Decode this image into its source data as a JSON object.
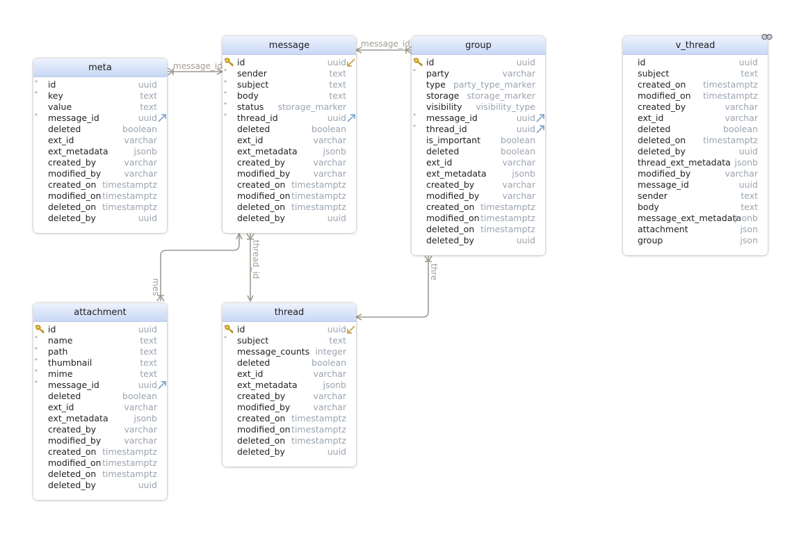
{
  "tables": {
    "meta": {
      "title": "meta",
      "rows": [
        {
          "name": "id",
          "type": "uuid",
          "nn": true
        },
        {
          "name": "key",
          "type": "text",
          "nn": true
        },
        {
          "name": "value",
          "type": "text",
          "nn": false
        },
        {
          "name": "message_id",
          "type": "uuid",
          "nn": true,
          "fk": true
        },
        {
          "name": "deleted",
          "type": "boolean",
          "nn": false
        },
        {
          "name": "ext_id",
          "type": "varchar",
          "nn": false
        },
        {
          "name": "ext_metadata",
          "type": "jsonb",
          "nn": false
        },
        {
          "name": "created_by",
          "type": "varchar",
          "nn": false
        },
        {
          "name": "modified_by",
          "type": "varchar",
          "nn": false
        },
        {
          "name": "created_on",
          "type": "timestamptz",
          "nn": false
        },
        {
          "name": "modified_on",
          "type": "timestamptz",
          "nn": false
        },
        {
          "name": "deleted_on",
          "type": "timestamptz",
          "nn": false
        },
        {
          "name": "deleted_by",
          "type": "uuid",
          "nn": false
        }
      ]
    },
    "message": {
      "title": "message",
      "rows": [
        {
          "name": "id",
          "type": "uuid",
          "nn": true,
          "pk": true,
          "ref": true
        },
        {
          "name": "sender",
          "type": "text",
          "nn": true
        },
        {
          "name": "subject",
          "type": "text",
          "nn": true
        },
        {
          "name": "body",
          "type": "text",
          "nn": true
        },
        {
          "name": "status",
          "type": "storage_marker",
          "nn": true
        },
        {
          "name": "thread_id",
          "type": "uuid",
          "nn": true,
          "fk": true
        },
        {
          "name": "deleted",
          "type": "boolean",
          "nn": false
        },
        {
          "name": "ext_id",
          "type": "varchar",
          "nn": false
        },
        {
          "name": "ext_metadata",
          "type": "jsonb",
          "nn": false
        },
        {
          "name": "created_by",
          "type": "varchar",
          "nn": false
        },
        {
          "name": "modified_by",
          "type": "varchar",
          "nn": false
        },
        {
          "name": "created_on",
          "type": "timestamptz",
          "nn": false
        },
        {
          "name": "modified_on",
          "type": "timestamptz",
          "nn": false
        },
        {
          "name": "deleted_on",
          "type": "timestamptz",
          "nn": false
        },
        {
          "name": "deleted_by",
          "type": "uuid",
          "nn": false
        }
      ]
    },
    "group": {
      "title": "group",
      "rows": [
        {
          "name": "id",
          "type": "uuid",
          "nn": true,
          "pk": true
        },
        {
          "name": "party",
          "type": "varchar",
          "nn": true
        },
        {
          "name": "type",
          "type": "party_type_marker",
          "nn": false
        },
        {
          "name": "storage",
          "type": "storage_marker",
          "nn": false
        },
        {
          "name": "visibility",
          "type": "visibility_type",
          "nn": false
        },
        {
          "name": "message_id",
          "type": "uuid",
          "nn": true,
          "fk": true
        },
        {
          "name": "thread_id",
          "type": "uuid",
          "nn": true,
          "fk": true
        },
        {
          "name": "is_important",
          "type": "boolean",
          "nn": false
        },
        {
          "name": "deleted",
          "type": "boolean",
          "nn": false
        },
        {
          "name": "ext_id",
          "type": "varchar",
          "nn": false
        },
        {
          "name": "ext_metadata",
          "type": "jsonb",
          "nn": false
        },
        {
          "name": "created_by",
          "type": "varchar",
          "nn": false
        },
        {
          "name": "modified_by",
          "type": "varchar",
          "nn": false
        },
        {
          "name": "created_on",
          "type": "timestamptz",
          "nn": false
        },
        {
          "name": "modified_on",
          "type": "timestamptz",
          "nn": false
        },
        {
          "name": "deleted_on",
          "type": "timestamptz",
          "nn": false
        },
        {
          "name": "deleted_by",
          "type": "uuid",
          "nn": false
        }
      ]
    },
    "v_thread": {
      "title": "v_thread",
      "rows": [
        {
          "name": "id",
          "type": "uuid",
          "nn": false
        },
        {
          "name": "subject",
          "type": "text",
          "nn": false
        },
        {
          "name": "created_on",
          "type": "timestamptz",
          "nn": false
        },
        {
          "name": "modified_on",
          "type": "timestamptz",
          "nn": false
        },
        {
          "name": "created_by",
          "type": "varchar",
          "nn": false
        },
        {
          "name": "ext_id",
          "type": "varchar",
          "nn": false
        },
        {
          "name": "deleted",
          "type": "boolean",
          "nn": false
        },
        {
          "name": "deleted_on",
          "type": "timestamptz",
          "nn": false
        },
        {
          "name": "deleted_by",
          "type": "uuid",
          "nn": false
        },
        {
          "name": "thread_ext_metadata",
          "type": "jsonb",
          "nn": false
        },
        {
          "name": "modified_by",
          "type": "varchar",
          "nn": false
        },
        {
          "name": "message_id",
          "type": "uuid",
          "nn": false
        },
        {
          "name": "sender",
          "type": "text",
          "nn": false
        },
        {
          "name": "body",
          "type": "text",
          "nn": false
        },
        {
          "name": "message_ext_metadata",
          "type": "jsonb",
          "nn": false
        },
        {
          "name": "attachment",
          "type": "json",
          "nn": false
        },
        {
          "name": "group",
          "type": "json",
          "nn": false
        }
      ]
    },
    "attachment": {
      "title": "attachment",
      "rows": [
        {
          "name": "id",
          "type": "uuid",
          "nn": true,
          "pk": true
        },
        {
          "name": "name",
          "type": "text",
          "nn": true
        },
        {
          "name": "path",
          "type": "text",
          "nn": true
        },
        {
          "name": "thumbnail",
          "type": "text",
          "nn": true
        },
        {
          "name": "mime",
          "type": "text",
          "nn": true
        },
        {
          "name": "message_id",
          "type": "uuid",
          "nn": true,
          "fk": true
        },
        {
          "name": "deleted",
          "type": "boolean",
          "nn": false
        },
        {
          "name": "ext_id",
          "type": "varchar",
          "nn": false
        },
        {
          "name": "ext_metadata",
          "type": "jsonb",
          "nn": false
        },
        {
          "name": "created_by",
          "type": "varchar",
          "nn": false
        },
        {
          "name": "modified_by",
          "type": "varchar",
          "nn": false
        },
        {
          "name": "created_on",
          "type": "timestamptz",
          "nn": false
        },
        {
          "name": "modified_on",
          "type": "timestamptz",
          "nn": false
        },
        {
          "name": "deleted_on",
          "type": "timestamptz",
          "nn": false
        },
        {
          "name": "deleted_by",
          "type": "uuid",
          "nn": false
        }
      ]
    },
    "thread": {
      "title": "thread",
      "rows": [
        {
          "name": "id",
          "type": "uuid",
          "nn": true,
          "pk": true,
          "ref": true
        },
        {
          "name": "subject",
          "type": "text",
          "nn": true
        },
        {
          "name": "message_counts",
          "type": "integer",
          "nn": false
        },
        {
          "name": "deleted",
          "type": "boolean",
          "nn": false
        },
        {
          "name": "ext_id",
          "type": "varchar",
          "nn": false
        },
        {
          "name": "ext_metadata",
          "type": "jsonb",
          "nn": false
        },
        {
          "name": "created_by",
          "type": "varchar",
          "nn": false
        },
        {
          "name": "modified_by",
          "type": "varchar",
          "nn": false
        },
        {
          "name": "created_on",
          "type": "timestamptz",
          "nn": false
        },
        {
          "name": "modified_on",
          "type": "timestamptz",
          "nn": false
        },
        {
          "name": "deleted_on",
          "type": "timestamptz",
          "nn": false
        },
        {
          "name": "deleted_by",
          "type": "uuid",
          "nn": false
        }
      ]
    }
  },
  "relations": {
    "meta_message": "message_id",
    "group_message": "message_id",
    "attachment_message": "mes",
    "message_thread": "thread_id",
    "group_thread": "thre"
  },
  "icons": {
    "primary_key": "key-icon",
    "foreign_key": "link-arrow-icon",
    "referenced": "referenced-arrow-icon",
    "view": "binoculars-icon"
  },
  "colors": {
    "header_top": "#eef3fd",
    "header_bottom": "#c9d8f6",
    "column_type": "#9aa4b0",
    "relation_line": "#9e9990",
    "key": "#d9a312",
    "fk_arrow": "#7fa6cf",
    "ref_arrow": "#c8a24e"
  }
}
